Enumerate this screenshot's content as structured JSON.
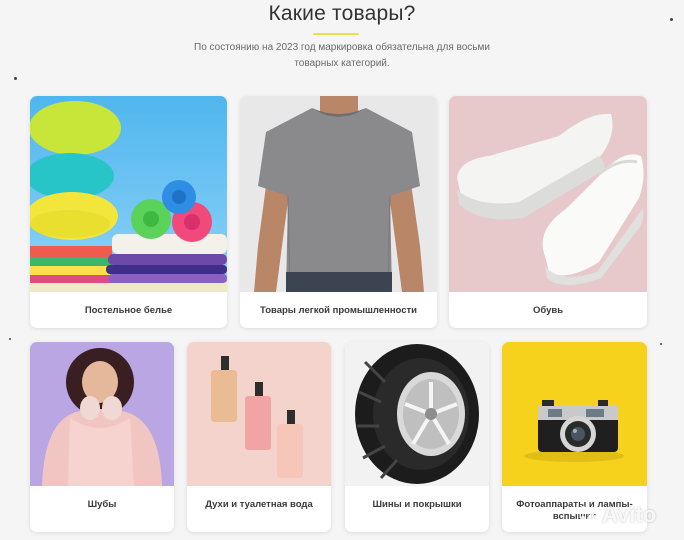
{
  "header": {
    "title": "Какие товары?",
    "subtitle": "По состоянию на 2023 год маркировка обязательна для восьми товарных категорий."
  },
  "categories": [
    {
      "label": "Постельное белье",
      "icon": "bedding-photo"
    },
    {
      "label": "Товары легкой промышленности",
      "icon": "tshirt-photo"
    },
    {
      "label": "Обувь",
      "icon": "sneakers-photo"
    },
    {
      "label": "Шубы",
      "icon": "fur-coat-photo"
    },
    {
      "label": "Духи и туалетная вода",
      "icon": "perfume-photo"
    },
    {
      "label": "Шины и покрышки",
      "icon": "tire-photo"
    },
    {
      "label": "Фотоаппараты и лампы-вспышки",
      "icon": "camera-photo"
    }
  ],
  "watermark": {
    "text": "Avito"
  },
  "colors": {
    "accent": "#f0df40",
    "background": "#f5f5f5",
    "card": "#ffffff"
  }
}
